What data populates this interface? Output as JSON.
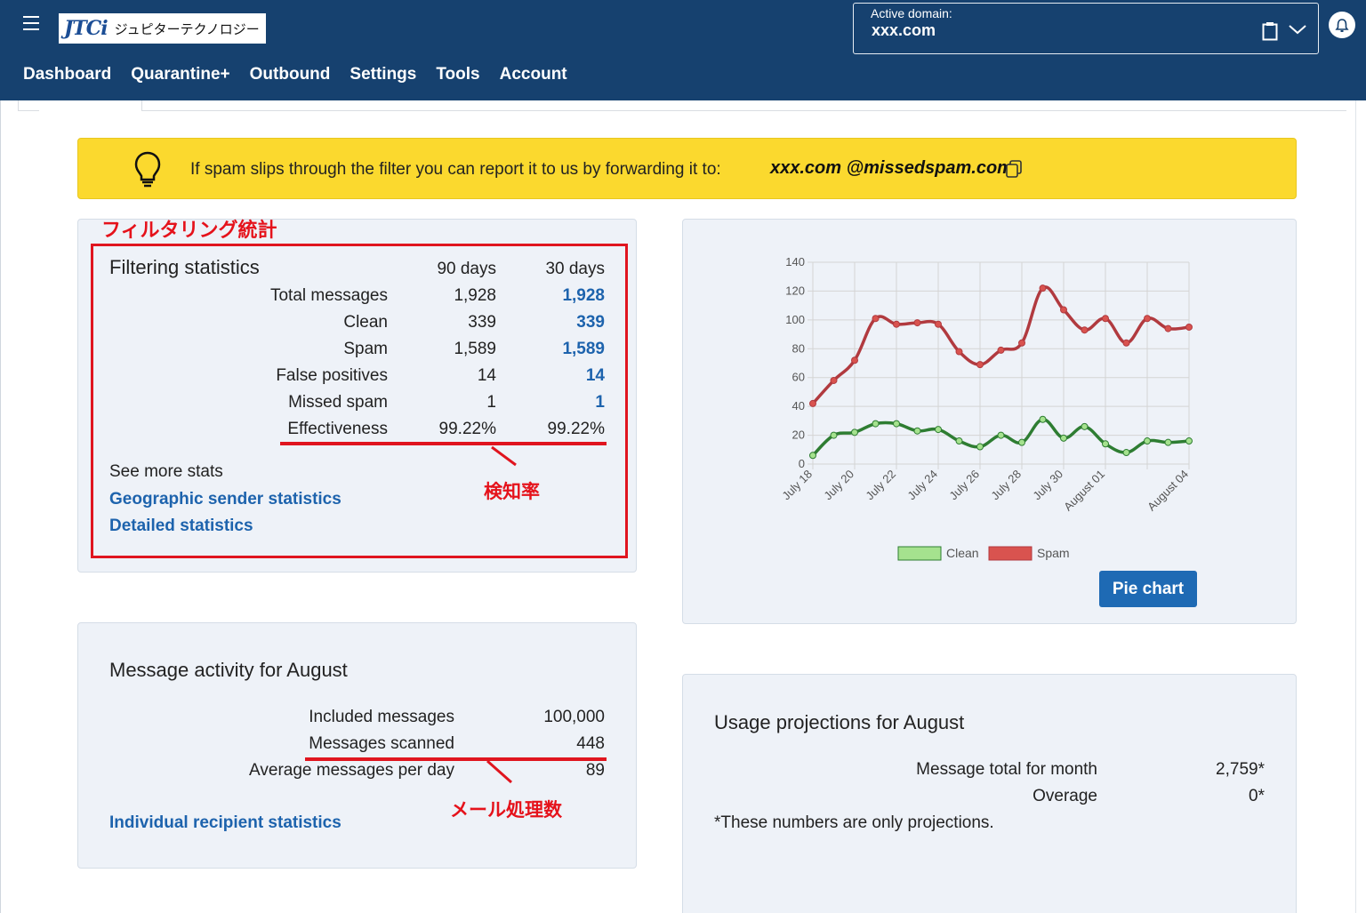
{
  "header": {
    "logo_mark": "JTCi",
    "logo_text": "ジュピターテクノロジー",
    "domain_label": "Active domain:",
    "domain_value": "xxx.com"
  },
  "nav": {
    "items": [
      "Dashboard",
      "Quarantine+",
      "Outbound",
      "Settings",
      "Tools",
      "Account"
    ]
  },
  "banner": {
    "text": "If spam slips through the filter you can report it to us by forwarding it to:",
    "email": "xxx.com @missedspam.com"
  },
  "filtering": {
    "annotation_title": "フィルタリング統計",
    "title": "Filtering statistics",
    "col_90": "90 days",
    "col_30": "30 days",
    "rows": [
      {
        "label": "Total messages",
        "d90": "1,928",
        "d30": "1,928"
      },
      {
        "label": "Clean",
        "d90": "339",
        "d30": "339"
      },
      {
        "label": "Spam",
        "d90": "1,589",
        "d30": "1,589"
      },
      {
        "label": "False positives",
        "d90": "14",
        "d30": "14"
      },
      {
        "label": "Missed spam",
        "d90": "1",
        "d30": "1"
      },
      {
        "label": "Effectiveness",
        "d90": "99.22%",
        "d30": "99.22%"
      }
    ],
    "see_more": "See more stats",
    "link_geo": "Geographic sender statistics",
    "link_detailed": "Detailed statistics",
    "annotation_rate": "検知率"
  },
  "activity": {
    "title": "Message activity for August",
    "rows": [
      {
        "label": "Included messages",
        "value": "100,000"
      },
      {
        "label": "Messages scanned",
        "value": "448"
      },
      {
        "label": "Average messages per day",
        "value": "89"
      }
    ],
    "link_recipient": "Individual recipient statistics",
    "annotation_processed": "メール処理数"
  },
  "usage": {
    "title": "Usage projections for August",
    "rows": [
      {
        "label": "Message total for month",
        "value": "2,759*"
      },
      {
        "label": "Overage",
        "value": "0*"
      }
    ],
    "note": "*These numbers are only projections."
  },
  "chart_button": "Pie chart",
  "colors": {
    "header_bg": "#16416f",
    "banner_bg": "#fbd92e",
    "link": "#1d63ad",
    "annotation_red": "#e0151f",
    "clean_line": "#2e7d32",
    "clean_point": "#a5e28e",
    "spam_line": "#b13a3f",
    "spam_point": "#d9534f"
  },
  "chart_data": {
    "type": "line",
    "x": [
      "July 18",
      "July 19",
      "July 20",
      "July 21",
      "July 22",
      "July 23",
      "July 24",
      "July 25",
      "July 26",
      "July 27",
      "July 28",
      "July 29",
      "July 30",
      "July 31",
      "August 01",
      "August 02",
      "August 03",
      "August 04",
      "August 05"
    ],
    "x_tick_labels": [
      "July 18",
      "July 20",
      "July 22",
      "July 24",
      "July 26",
      "July 28",
      "July 30",
      "August 01",
      "August 04"
    ],
    "y_ticks": [
      0,
      20,
      40,
      60,
      80,
      100,
      120,
      140
    ],
    "ylim": [
      0,
      140
    ],
    "grid": true,
    "legend": "bottom",
    "series": [
      {
        "name": "Clean",
        "values": [
          6,
          20,
          22,
          28,
          28,
          23,
          24,
          16,
          12,
          20,
          15,
          31,
          18,
          26,
          14,
          8,
          16,
          15,
          16
        ]
      },
      {
        "name": "Spam",
        "values": [
          42,
          58,
          72,
          101,
          97,
          98,
          97,
          78,
          69,
          79,
          84,
          122,
          107,
          93,
          101,
          84,
          101,
          94,
          95
        ]
      }
    ]
  }
}
